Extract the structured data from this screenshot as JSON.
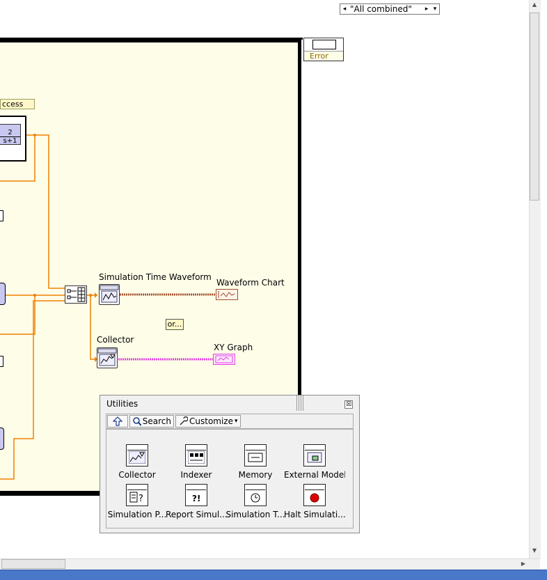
{
  "case_selector": {
    "value": "\"All combined\"",
    "left_arrow": "◂",
    "right_arrow": "▸",
    "dropdown": "▾"
  },
  "error_terminal": {
    "label": "Error"
  },
  "diagram": {
    "process_label": "ccess",
    "node_const": {
      "line1": "2",
      "line2": "s+1"
    },
    "sim_time_waveform_label": "Simulation Time Waveform",
    "waveform_chart_label": "Waveform Chart",
    "or_label": "or...",
    "collector_label": "Collector",
    "xy_graph_label": "XY Graph"
  },
  "palette": {
    "title": "Utilities",
    "close": "☒",
    "up_icon": "up-arrow-icon",
    "search_label": "Search",
    "customize_label": "Customize",
    "items": [
      {
        "label": "Collector",
        "icon": "collector-icon"
      },
      {
        "label": "Indexer",
        "icon": "indexer-icon"
      },
      {
        "label": "Memory",
        "icon": "memory-icon"
      },
      {
        "label": "External Model",
        "icon": "external-model-icon"
      },
      {
        "label": "Simulation P...",
        "icon": "simulation-parameters-icon"
      },
      {
        "label": "Report Simul...",
        "icon": "report-simulation-error-icon"
      },
      {
        "label": "Simulation T...",
        "icon": "simulation-time-icon"
      },
      {
        "label": "Halt Simulati...",
        "icon": "halt-simulation-icon"
      }
    ]
  },
  "colors": {
    "orange_wire": "#f08000",
    "pink_wire": "#e040e0",
    "waveform_wire": "#a0522d",
    "diagram_bg": "#fefde8"
  }
}
